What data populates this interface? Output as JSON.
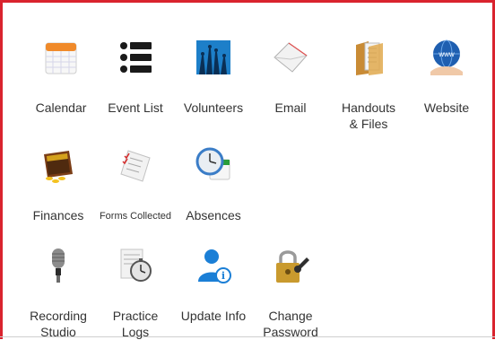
{
  "grid": {
    "rows": [
      {
        "tiles": [
          {
            "label": "Calendar",
            "icon": "calendar-icon"
          },
          {
            "label": "Event List",
            "icon": "list-icon"
          },
          {
            "label": "Volunteers",
            "icon": "raised-hands-icon"
          },
          {
            "label": "Email",
            "icon": "envelope-icon"
          },
          {
            "label": "Handouts\n& Files",
            "icon": "folder-icon"
          },
          {
            "label": "Website",
            "icon": "globe-icon"
          }
        ]
      },
      {
        "tiles": [
          {
            "label": "Finances",
            "icon": "wallet-icon"
          },
          {
            "label": "Forms Collected",
            "icon": "checklist-icon"
          },
          {
            "label": "Absences",
            "icon": "clock-calendar-icon"
          }
        ]
      },
      {
        "tiles": [
          {
            "label": "Recording\nStudio",
            "icon": "microphone-icon"
          },
          {
            "label": "Practice\nLogs",
            "icon": "stopwatch-log-icon"
          },
          {
            "label": "Update Info",
            "icon": "user-info-icon"
          },
          {
            "label": "Change\nPassword",
            "icon": "padlock-key-icon"
          }
        ]
      }
    ]
  },
  "colors": {
    "frame": "#d9232e",
    "text": "#333333"
  }
}
